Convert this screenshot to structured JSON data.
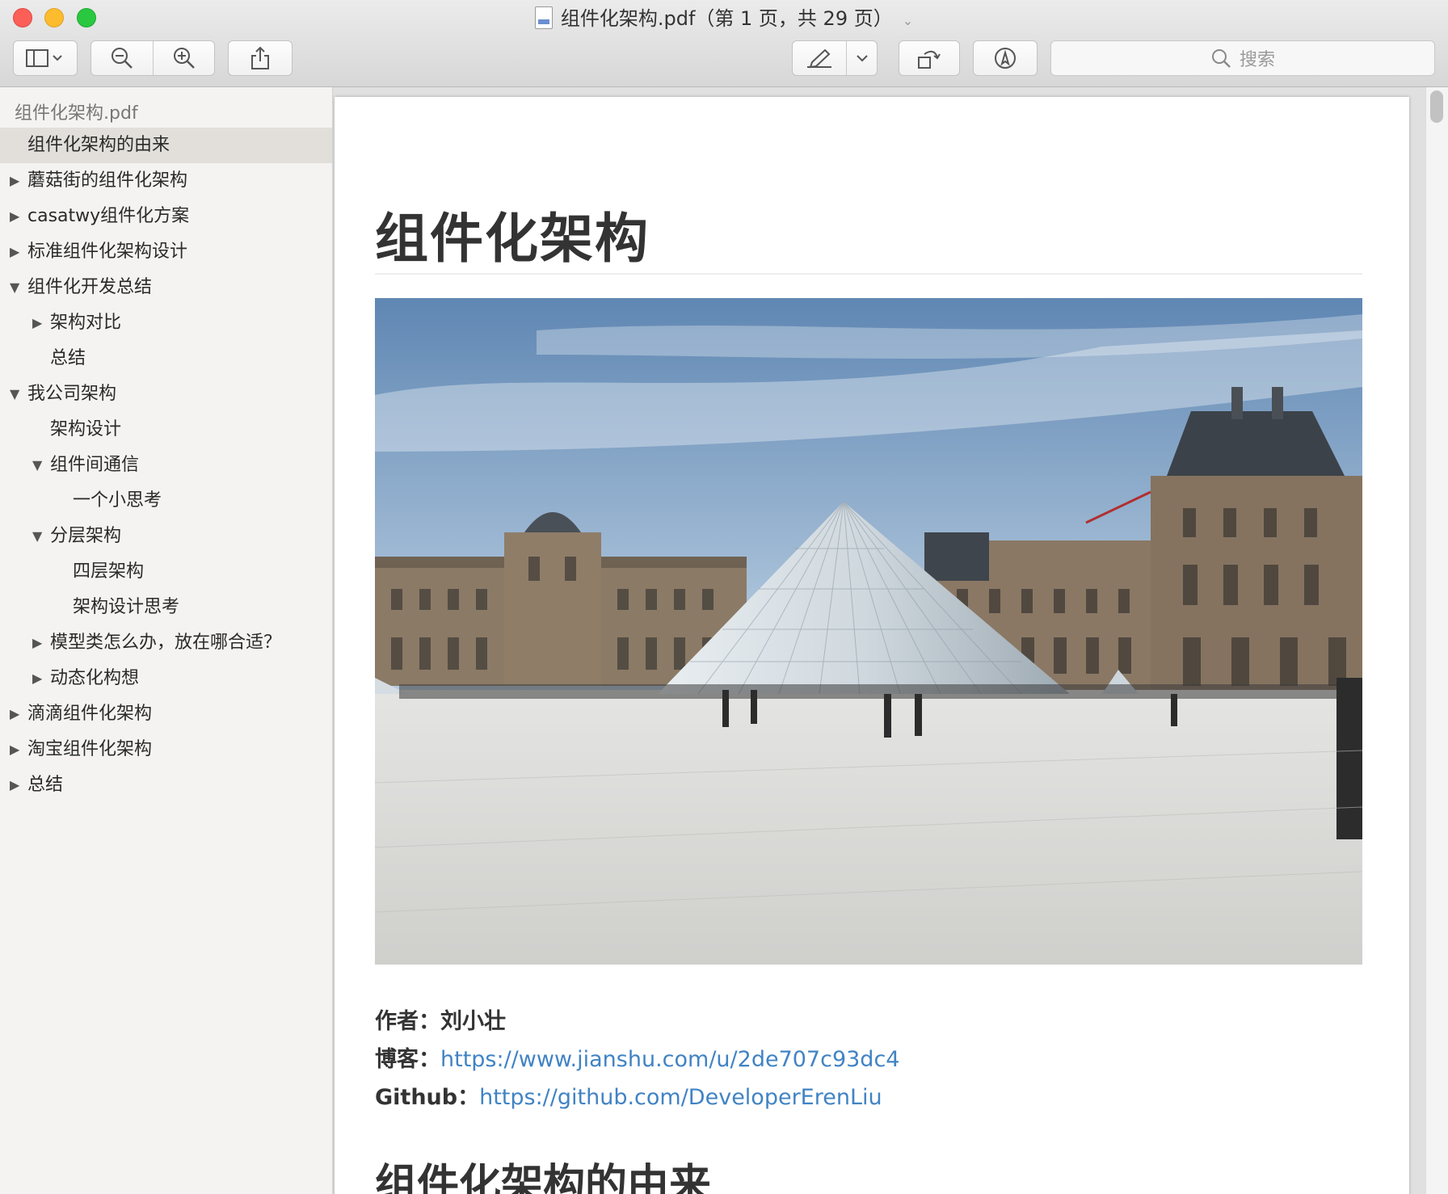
{
  "window": {
    "title": "组件化架构.pdf（第 1 页，共 29 页）"
  },
  "toolbar": {
    "sidebar_toggle_icon": "sidebar-icon",
    "zoom_out_icon": "zoom-out-icon",
    "zoom_in_icon": "zoom-in-icon",
    "share_icon": "share-icon",
    "markup_icon": "pen-icon",
    "rotate_icon": "rotate-icon",
    "annotate_icon": "markup-icon",
    "search_placeholder": "搜索"
  },
  "sidebar": {
    "file_name": "组件化架构.pdf",
    "items": [
      {
        "label": "组件化架构的由来",
        "level": 0,
        "toggle": "none",
        "selected": true
      },
      {
        "label": "蘑菇街的组件化架构",
        "level": 0,
        "toggle": "collapsed"
      },
      {
        "label": "casatwy组件化方案",
        "level": 0,
        "toggle": "collapsed"
      },
      {
        "label": "标准组件化架构设计",
        "level": 0,
        "toggle": "collapsed"
      },
      {
        "label": "组件化开发总结",
        "level": 0,
        "toggle": "expanded"
      },
      {
        "label": "架构对比",
        "level": 1,
        "toggle": "collapsed"
      },
      {
        "label": "总结",
        "level": 1,
        "toggle": "none"
      },
      {
        "label": "我公司架构",
        "level": 0,
        "toggle": "expanded"
      },
      {
        "label": "架构设计",
        "level": 1,
        "toggle": "none"
      },
      {
        "label": "组件间通信",
        "level": 1,
        "toggle": "expanded"
      },
      {
        "label": "一个小思考",
        "level": 2,
        "toggle": "none"
      },
      {
        "label": "分层架构",
        "level": 1,
        "toggle": "expanded"
      },
      {
        "label": "四层架构",
        "level": 2,
        "toggle": "none"
      },
      {
        "label": "架构设计思考",
        "level": 2,
        "toggle": "none"
      },
      {
        "label": "模型类怎么办，放在哪合适？",
        "level": 1,
        "toggle": "collapsed"
      },
      {
        "label": "动态化构想",
        "level": 1,
        "toggle": "collapsed"
      },
      {
        "label": "滴滴组件化架构",
        "level": 0,
        "toggle": "collapsed"
      },
      {
        "label": "淘宝组件化架构",
        "level": 0,
        "toggle": "collapsed"
      },
      {
        "label": "总结",
        "level": 0,
        "toggle": "collapsed"
      }
    ]
  },
  "document": {
    "title": "组件化架构",
    "author_label": "作者：",
    "author": "刘小壮",
    "blog_label": "博客：",
    "blog_url": "https://www.jianshu.com/u/2de707c93dc4",
    "github_label": "Github：",
    "github_url": "https://github.com/DeveloperErenLiu",
    "section_heading": "组件化架构的由来"
  },
  "colors": {
    "link": "#4183c4",
    "selection": "#e2dfdb"
  }
}
